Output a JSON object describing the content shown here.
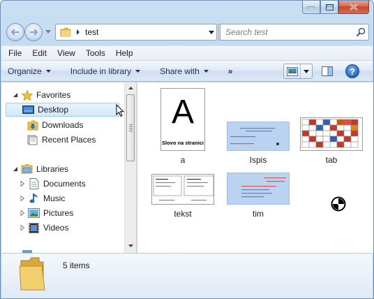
{
  "window": {
    "address": {
      "path_segment": "test"
    },
    "search": {
      "placeholder": "Search test"
    }
  },
  "menu": [
    "File",
    "Edit",
    "View",
    "Tools",
    "Help"
  ],
  "toolbar": {
    "organize": "Organize",
    "include_in_library": "Include in library",
    "share_with": "Share with",
    "more": "»",
    "help": "?"
  },
  "nav": {
    "favorites": "Favorites",
    "desktop": "Desktop",
    "downloads": "Downloads",
    "recent_places": "Recent Places",
    "libraries": "Libraries",
    "documents": "Documents",
    "music": "Music",
    "pictures": "Pictures",
    "videos": "Videos"
  },
  "files": [
    {
      "name": "a",
      "thumb_letter": "A",
      "thumb_caption": "Slovo na stranici"
    },
    {
      "name": "Ispis"
    },
    {
      "name": "tab"
    },
    {
      "name": "tekst"
    },
    {
      "name": "tim"
    }
  ],
  "details": {
    "count": "5 items"
  }
}
